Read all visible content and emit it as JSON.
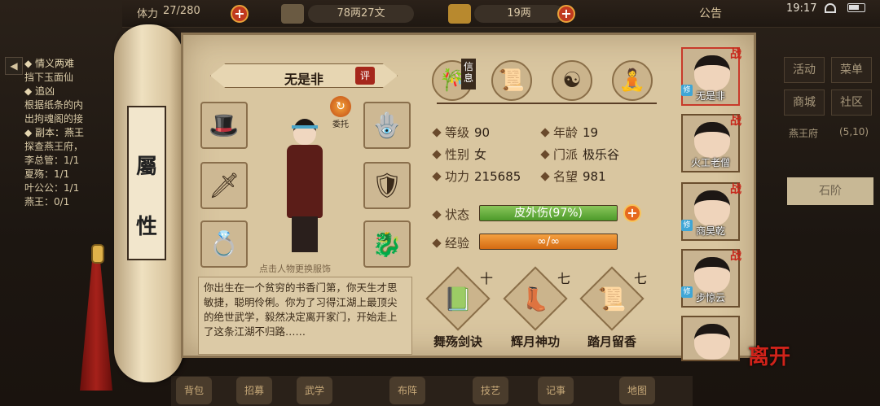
{
  "topbar": {
    "stamina_label": "体力",
    "stamina": "27/280",
    "money": "78两27文",
    "gold": "19两",
    "announce": "公告",
    "clock": "19:17"
  },
  "quest": {
    "lines": [
      "◆ 情义两难",
      "挡下玉面仙",
      "◆ 追凶",
      "根据纸条的内",
      "出拘魂阁的接",
      "◆ 副本：燕王",
      "探查燕王府，",
      "李总管：1/1",
      "夏殇：1/1",
      "叶公公：1/1",
      "燕王：0/1"
    ]
  },
  "scroll": {
    "title_top": "屬",
    "title_bottom": "性"
  },
  "character": {
    "name": "无是非",
    "review": "评",
    "entrust": "委托",
    "hint": "点击人物更换服饰",
    "bio": "你出生在一个贫穷的书香门第，你天生才思敏捷，聪明伶俐。你为了习得江湖上最顶尖的绝世武学，毅然决定离开家门，开始走上了这条江湖不归路……"
  },
  "tabs": {
    "info": "信息"
  },
  "stats": {
    "level_label": "等级",
    "level": "90",
    "age_label": "年龄",
    "age": "19",
    "gender_label": "性别",
    "gender": "女",
    "sect_label": "门派",
    "sect": "极乐谷",
    "power_label": "功力",
    "power": "215685",
    "fame_label": "名望",
    "fame": "981",
    "status_label": "状态",
    "status": "皮外伤(97%)",
    "status_ratio": 0.97,
    "exp_label": "经验",
    "exp": "∞/∞"
  },
  "skills": [
    {
      "name": "舞殇剑诀",
      "level": "十"
    },
    {
      "name": "辉月神功",
      "level": "七"
    },
    {
      "name": "踏月留香",
      "level": "七"
    }
  ],
  "party": [
    {
      "name": "无是非",
      "mark": "战"
    },
    {
      "name": "火工老僧",
      "mark": "战"
    },
    {
      "name": "商昊乾",
      "mark": "战"
    },
    {
      "name": "步惊云",
      "mark": "战"
    },
    {
      "name": "",
      "mark": ""
    }
  ],
  "party_badge": "修",
  "leave_label": "离开",
  "right_menu": {
    "activity": "活动",
    "menu": "菜单",
    "shop": "商城",
    "community": "社区",
    "map_name": "燕王府",
    "coords": "(5,10)",
    "loc": "石阶"
  },
  "bottom": [
    "背包",
    "招募",
    "武学",
    "布阵",
    "技艺",
    "记事",
    "地图"
  ]
}
